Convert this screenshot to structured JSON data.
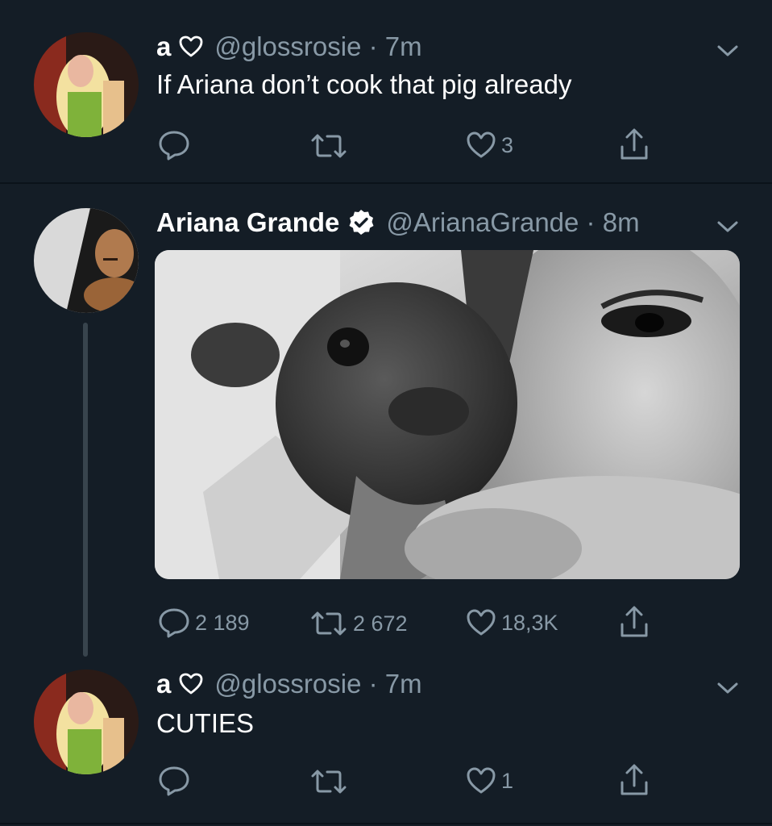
{
  "tweets": [
    {
      "display_name": "a",
      "handle": "@glossrosie",
      "time": "7m",
      "text": "If Ariana don’t cook that pig already",
      "replies": "",
      "retweets": "",
      "likes": "3"
    },
    {
      "display_name": "Ariana Grande",
      "handle": "@ArianaGrande",
      "time": "8m",
      "text": "",
      "verified": true,
      "replies": "2 189",
      "retweets": "2 672",
      "likes": "18,3K"
    },
    {
      "display_name": "a",
      "handle": "@glossrosie",
      "time": "7m",
      "text": "CUTIES",
      "replies": "",
      "retweets": "",
      "likes": "1"
    }
  ],
  "colors": {
    "background": "#141d26",
    "secondary_text": "#8899a6",
    "verified_bg": "#ffffff"
  },
  "icons": [
    "heart-outline-icon",
    "chevron-down-icon",
    "reply-icon",
    "retweet-icon",
    "like-icon",
    "share-icon",
    "verified-badge-icon"
  ]
}
